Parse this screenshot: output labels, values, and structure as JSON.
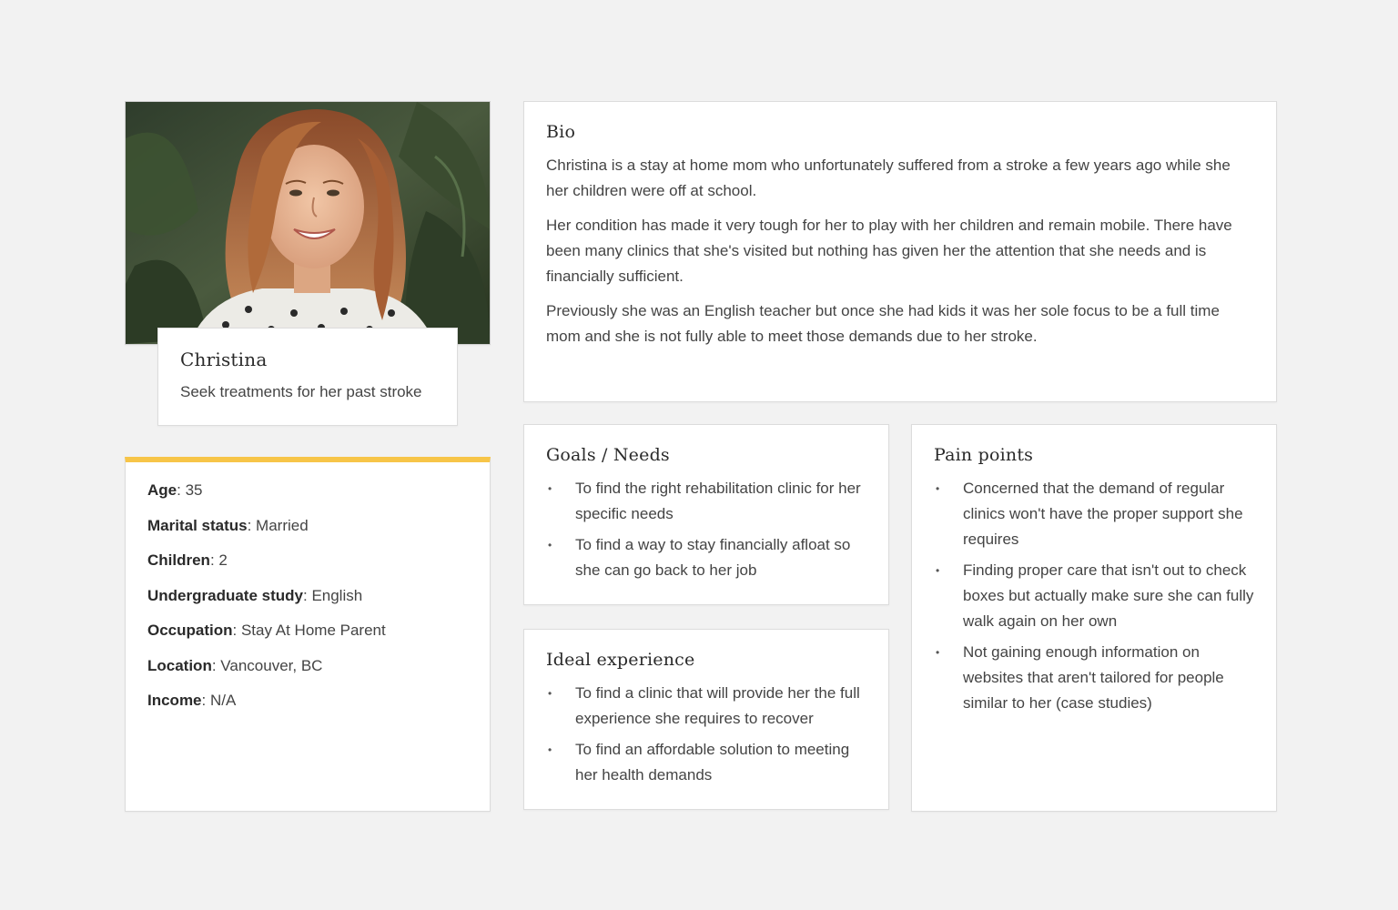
{
  "persona": {
    "name": "Christina",
    "tagline": "Seek treatments for her past stroke"
  },
  "stats": [
    {
      "label": "Age",
      "value": "35"
    },
    {
      "label": "Marital status",
      "value": "Married"
    },
    {
      "label": "Children",
      "value": "2"
    },
    {
      "label": "Undergraduate study",
      "value": "English"
    },
    {
      "label": "Occupation",
      "value": "Stay At Home Parent"
    },
    {
      "label": "Location",
      "value": "Vancouver, BC"
    },
    {
      "label": "Income",
      "value": "N/A"
    }
  ],
  "bio": {
    "title": "Bio",
    "paragraphs": [
      "Christina is a stay at home mom who unfortunately suffered from a stroke a few years ago while she her children were off at school.",
      "Her condition has made it very tough for her to play with her children and remain mobile. There have been many clinics that she's visited but nothing has given her the attention that she needs and is financially sufficient.",
      "Previously she was an English teacher but once she had kids it was her sole focus to be a full time mom and she is not fully able to meet those demands due to her stroke."
    ]
  },
  "goals": {
    "title": "Goals / Needs",
    "items": [
      "To find the right rehabilitation clinic for her specific needs",
      "To find a way to stay financially afloat so she can go back to her job"
    ]
  },
  "ideal": {
    "title": "Ideal experience",
    "items": [
      "To find a clinic that will provide her the full experience she requires to recover",
      "To find an affordable solution to meeting her health demands"
    ]
  },
  "pain": {
    "title": "Pain points",
    "items": [
      "Concerned that the demand of regular clinics won't have the proper support she requires",
      "Finding proper care that isn't out to check boxes but actually make sure she can fully walk again on her own",
      "Not gaining enough information on websites that aren't tailored for people similar to her (case studies)"
    ]
  },
  "colors": {
    "accent": "#f7c548",
    "background": "#f2f2f2",
    "card": "#ffffff"
  }
}
